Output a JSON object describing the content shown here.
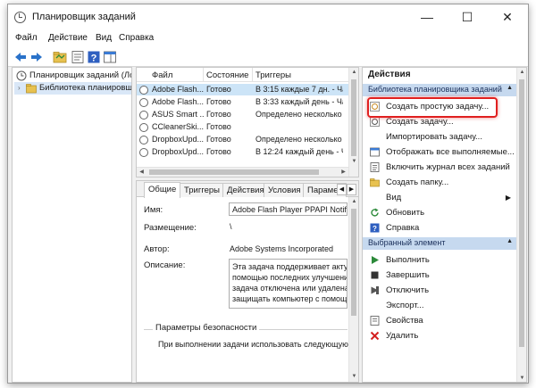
{
  "window": {
    "title": "Планировщик заданий",
    "minimize_glyph": "—",
    "maximize_glyph": "☐",
    "close_glyph": "✕"
  },
  "menu": [
    "Файл",
    "Действие",
    "Вид",
    "Справка"
  ],
  "toolbar_icons": [
    "back-arrow-icon",
    "forward-arrow-icon",
    "folder-icon",
    "properties-icon",
    "help-icon",
    "panel-icon"
  ],
  "tree": {
    "root": "Планировщик заданий (Ло",
    "library": "Библиотека планировщ"
  },
  "task_list": {
    "columns": [
      "Файл",
      "Состояние",
      "Триггеры"
    ],
    "rows": [
      {
        "name": "Adobe Flash...",
        "status": "Готово",
        "trigger": "В 3:15 каждые 7 дн. - Част"
      },
      {
        "name": "Adobe Flash...",
        "status": "Готово",
        "trigger": "В 3:33 каждый день - Част"
      },
      {
        "name": "ASUS Smart ...",
        "status": "Готово",
        "trigger": "Определено несколько т"
      },
      {
        "name": "CCleanerSki...",
        "status": "Готово",
        "trigger": ""
      },
      {
        "name": "DropboxUpd...",
        "status": "Готово",
        "trigger": "Определено несколько т"
      },
      {
        "name": "DropboxUpd...",
        "status": "Готово",
        "trigger": "В 12:24 каждый день - Ча"
      }
    ]
  },
  "details": {
    "tabs": [
      "Общие",
      "Триггеры",
      "Действия",
      "Условия",
      "Парамет"
    ],
    "name_label": "Имя:",
    "name_value": "Adobe Flash Player PPAPI Notifier",
    "location_label": "Размещение:",
    "location_value": "\\",
    "author_label": "Автор:",
    "author_value": "Adobe Systems Incorporated",
    "description_label": "Описание:",
    "description_lines": [
      "Эта задача поддерживает актуал",
      "помощью последних улучшени",
      "задача отключена или удалена,",
      "защищать компьютер с помощ"
    ],
    "security_title": "Параметры безопасности",
    "security_text": "При выполнении задачи использовать следующую уч"
  },
  "actions": {
    "header": "Действия",
    "section1": "Библиотека планировщика заданий",
    "items1": [
      {
        "label": "Создать простую задачу...",
        "icon": "create-basic-task-icon"
      },
      {
        "label": "Создать задачу...",
        "icon": "create-task-icon"
      },
      {
        "label": "Импортировать задачу...",
        "icon": ""
      },
      {
        "label": "Отображать все выполняемые...",
        "icon": "running-tasks-icon"
      },
      {
        "label": "Включить журнал всех заданий",
        "icon": "history-icon"
      },
      {
        "label": "Создать папку...",
        "icon": "new-folder-icon"
      },
      {
        "label": "Вид",
        "icon": ""
      },
      {
        "label": "Обновить",
        "icon": "refresh-icon"
      },
      {
        "label": "Справка",
        "icon": "help-icon"
      }
    ],
    "section2": "Выбранный элемент",
    "items2": [
      {
        "label": "Выполнить",
        "icon": "run-icon"
      },
      {
        "label": "Завершить",
        "icon": "stop-icon"
      },
      {
        "label": "Отключить",
        "icon": "disable-icon"
      },
      {
        "label": "Экспорт...",
        "icon": ""
      },
      {
        "label": "Свойства",
        "icon": "properties-icon"
      },
      {
        "label": "Удалить",
        "icon": "delete-icon"
      }
    ]
  },
  "colors": {
    "highlight": "#e02020",
    "selection": "#cce4f7",
    "section_bg": "#c6d9ef"
  }
}
